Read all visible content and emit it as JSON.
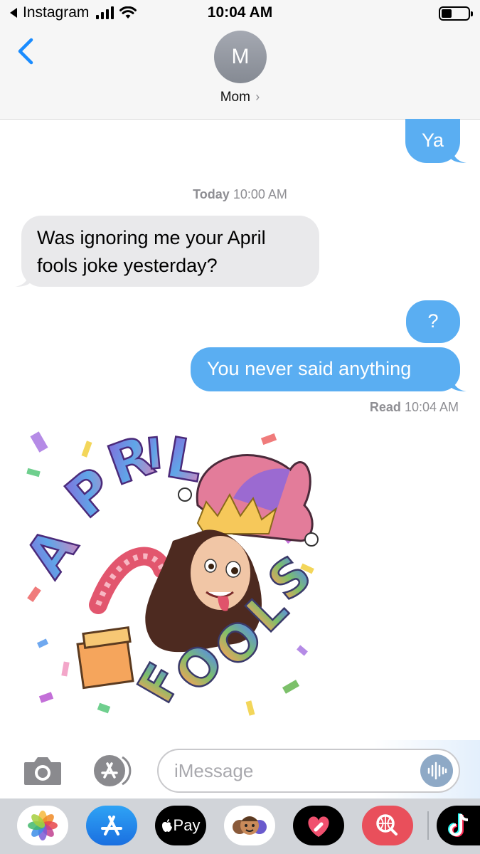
{
  "status_bar": {
    "back_app": "Instagram",
    "time": "10:04 AM",
    "battery_level": 0.4
  },
  "header": {
    "avatar_initial": "M",
    "contact_name": "Mom",
    "contact_chevron": "›",
    "back_icon": "chevron-left-icon"
  },
  "messages": [
    {
      "type": "sent",
      "text": "Ya"
    },
    {
      "type": "timestamp",
      "day": "Today",
      "time": "10:00 AM"
    },
    {
      "type": "received",
      "lines": [
        "Was ignoring me your April",
        "fools joke yesterday?"
      ]
    },
    {
      "type": "sent",
      "text": "?"
    },
    {
      "type": "sent",
      "text": "You never said anything"
    },
    {
      "type": "receipt",
      "label": "Read",
      "time": "10:04 AM"
    },
    {
      "type": "sticker",
      "words": [
        "APRIL",
        "FOOLS"
      ]
    }
  ],
  "input_bar": {
    "placeholder": "iMessage",
    "camera_icon": "camera-icon",
    "appstore_icon": "app-store-icon",
    "voice_icon": "audio-waveform-icon"
  },
  "app_drawer": [
    {
      "name": "photos-app-icon"
    },
    {
      "name": "app-store-app-icon"
    },
    {
      "name": "apple-pay-app-icon",
      "label": "Pay"
    },
    {
      "name": "memoji-app-icon"
    },
    {
      "name": "digital-touch-app-icon"
    },
    {
      "name": "web-search-app-icon"
    },
    {
      "name": "tiktok-app-icon"
    }
  ],
  "colors": {
    "sent_bubble": "#5aaef2",
    "received_bubble": "#e9e9eb",
    "ios_blue": "#1a8cff",
    "meta_gray": "#8e8e93"
  }
}
